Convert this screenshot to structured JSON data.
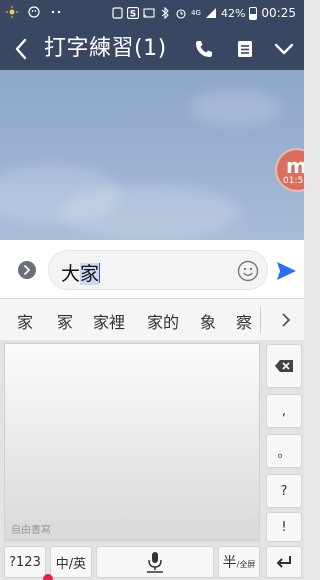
{
  "status_bar": {
    "battery": "42%",
    "time": "00:25",
    "network": "4G",
    "left_icons": [
      "sun-icon",
      "sticker-app-icon",
      "dots-icon"
    ],
    "right_icons": [
      "screenshot-icon",
      "s-app-icon",
      "cast-icon",
      "bluetooth-icon",
      "alarm-icon",
      "signal-icon",
      "battery-icon"
    ]
  },
  "header": {
    "title": "打字練習(1)",
    "icons": [
      "back-icon",
      "phone-icon",
      "menu-icon",
      "chevron-down-icon"
    ]
  },
  "floating_bubble": {
    "label": "m",
    "time": "01:5"
  },
  "input": {
    "typed": "大",
    "composing": "家"
  },
  "suggestions": [
    "家",
    "冢",
    "家裡",
    "家的",
    "象",
    "察"
  ],
  "keyboard": {
    "handwriting_label": "自由書寫",
    "side_keys": {
      "comma": ",",
      "period": "。",
      "question": "?",
      "exclaim": "!"
    },
    "bottom_keys": {
      "numbers": "?123",
      "lang": "中/英",
      "half_full_main": "半",
      "half_full_sub": "/全屏"
    }
  },
  "colors": {
    "header_bg": "#3a4763",
    "send_blue": "#2e6ff2",
    "float_bubble": "#d9705f"
  }
}
